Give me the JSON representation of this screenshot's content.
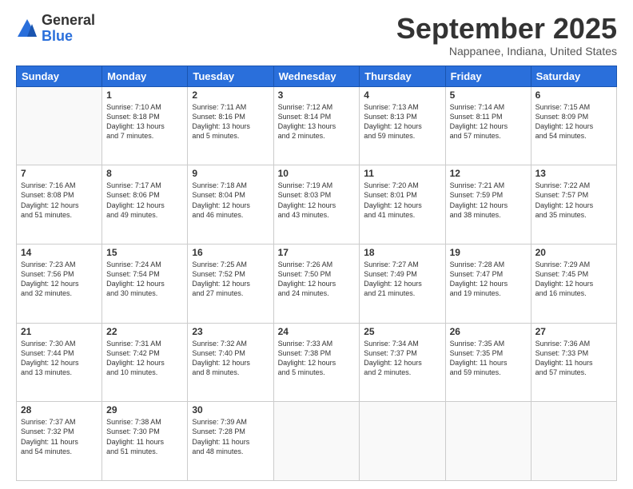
{
  "logo": {
    "general": "General",
    "blue": "Blue"
  },
  "header": {
    "month": "September 2025",
    "location": "Nappanee, Indiana, United States"
  },
  "weekdays": [
    "Sunday",
    "Monday",
    "Tuesday",
    "Wednesday",
    "Thursday",
    "Friday",
    "Saturday"
  ],
  "weeks": [
    [
      {
        "day": "",
        "info": ""
      },
      {
        "day": "1",
        "info": "Sunrise: 7:10 AM\nSunset: 8:18 PM\nDaylight: 13 hours\nand 7 minutes."
      },
      {
        "day": "2",
        "info": "Sunrise: 7:11 AM\nSunset: 8:16 PM\nDaylight: 13 hours\nand 5 minutes."
      },
      {
        "day": "3",
        "info": "Sunrise: 7:12 AM\nSunset: 8:14 PM\nDaylight: 13 hours\nand 2 minutes."
      },
      {
        "day": "4",
        "info": "Sunrise: 7:13 AM\nSunset: 8:13 PM\nDaylight: 12 hours\nand 59 minutes."
      },
      {
        "day": "5",
        "info": "Sunrise: 7:14 AM\nSunset: 8:11 PM\nDaylight: 12 hours\nand 57 minutes."
      },
      {
        "day": "6",
        "info": "Sunrise: 7:15 AM\nSunset: 8:09 PM\nDaylight: 12 hours\nand 54 minutes."
      }
    ],
    [
      {
        "day": "7",
        "info": "Sunrise: 7:16 AM\nSunset: 8:08 PM\nDaylight: 12 hours\nand 51 minutes."
      },
      {
        "day": "8",
        "info": "Sunrise: 7:17 AM\nSunset: 8:06 PM\nDaylight: 12 hours\nand 49 minutes."
      },
      {
        "day": "9",
        "info": "Sunrise: 7:18 AM\nSunset: 8:04 PM\nDaylight: 12 hours\nand 46 minutes."
      },
      {
        "day": "10",
        "info": "Sunrise: 7:19 AM\nSunset: 8:03 PM\nDaylight: 12 hours\nand 43 minutes."
      },
      {
        "day": "11",
        "info": "Sunrise: 7:20 AM\nSunset: 8:01 PM\nDaylight: 12 hours\nand 41 minutes."
      },
      {
        "day": "12",
        "info": "Sunrise: 7:21 AM\nSunset: 7:59 PM\nDaylight: 12 hours\nand 38 minutes."
      },
      {
        "day": "13",
        "info": "Sunrise: 7:22 AM\nSunset: 7:57 PM\nDaylight: 12 hours\nand 35 minutes."
      }
    ],
    [
      {
        "day": "14",
        "info": "Sunrise: 7:23 AM\nSunset: 7:56 PM\nDaylight: 12 hours\nand 32 minutes."
      },
      {
        "day": "15",
        "info": "Sunrise: 7:24 AM\nSunset: 7:54 PM\nDaylight: 12 hours\nand 30 minutes."
      },
      {
        "day": "16",
        "info": "Sunrise: 7:25 AM\nSunset: 7:52 PM\nDaylight: 12 hours\nand 27 minutes."
      },
      {
        "day": "17",
        "info": "Sunrise: 7:26 AM\nSunset: 7:50 PM\nDaylight: 12 hours\nand 24 minutes."
      },
      {
        "day": "18",
        "info": "Sunrise: 7:27 AM\nSunset: 7:49 PM\nDaylight: 12 hours\nand 21 minutes."
      },
      {
        "day": "19",
        "info": "Sunrise: 7:28 AM\nSunset: 7:47 PM\nDaylight: 12 hours\nand 19 minutes."
      },
      {
        "day": "20",
        "info": "Sunrise: 7:29 AM\nSunset: 7:45 PM\nDaylight: 12 hours\nand 16 minutes."
      }
    ],
    [
      {
        "day": "21",
        "info": "Sunrise: 7:30 AM\nSunset: 7:44 PM\nDaylight: 12 hours\nand 13 minutes."
      },
      {
        "day": "22",
        "info": "Sunrise: 7:31 AM\nSunset: 7:42 PM\nDaylight: 12 hours\nand 10 minutes."
      },
      {
        "day": "23",
        "info": "Sunrise: 7:32 AM\nSunset: 7:40 PM\nDaylight: 12 hours\nand 8 minutes."
      },
      {
        "day": "24",
        "info": "Sunrise: 7:33 AM\nSunset: 7:38 PM\nDaylight: 12 hours\nand 5 minutes."
      },
      {
        "day": "25",
        "info": "Sunrise: 7:34 AM\nSunset: 7:37 PM\nDaylight: 12 hours\nand 2 minutes."
      },
      {
        "day": "26",
        "info": "Sunrise: 7:35 AM\nSunset: 7:35 PM\nDaylight: 11 hours\nand 59 minutes."
      },
      {
        "day": "27",
        "info": "Sunrise: 7:36 AM\nSunset: 7:33 PM\nDaylight: 11 hours\nand 57 minutes."
      }
    ],
    [
      {
        "day": "28",
        "info": "Sunrise: 7:37 AM\nSunset: 7:32 PM\nDaylight: 11 hours\nand 54 minutes."
      },
      {
        "day": "29",
        "info": "Sunrise: 7:38 AM\nSunset: 7:30 PM\nDaylight: 11 hours\nand 51 minutes."
      },
      {
        "day": "30",
        "info": "Sunrise: 7:39 AM\nSunset: 7:28 PM\nDaylight: 11 hours\nand 48 minutes."
      },
      {
        "day": "",
        "info": ""
      },
      {
        "day": "",
        "info": ""
      },
      {
        "day": "",
        "info": ""
      },
      {
        "day": "",
        "info": ""
      }
    ]
  ]
}
